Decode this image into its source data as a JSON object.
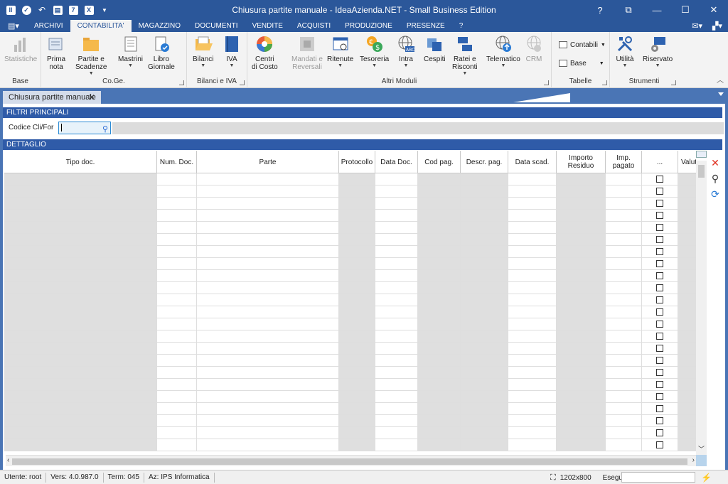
{
  "window": {
    "title": "Chiusura partite manuale - IdeaAzienda.NET - Small Business Edition",
    "help": "?",
    "restore": "⧉",
    "minimize": "—",
    "maximize": "☐",
    "close": "✕"
  },
  "qat": [
    "pin",
    "check",
    "undo",
    "print",
    "calc",
    "excel",
    "more"
  ],
  "ribbon_tabs": [
    {
      "label": "ARCHIVI",
      "active": false
    },
    {
      "label": "CONTABILITA'",
      "active": true
    },
    {
      "label": "MAGAZZINO",
      "active": false
    },
    {
      "label": "DOCUMENTI",
      "active": false
    },
    {
      "label": "VENDITE",
      "active": false
    },
    {
      "label": "ACQUISTI",
      "active": false
    },
    {
      "label": "PRODUZIONE",
      "active": false
    },
    {
      "label": "PRESENZE",
      "active": false
    },
    {
      "label": "?",
      "active": false
    }
  ],
  "ribbon": {
    "groups": [
      {
        "label": "Base"
      },
      {
        "label": "Co.Ge."
      },
      {
        "label": "Bilanci e IVA"
      },
      {
        "label": "Altri Moduli"
      },
      {
        "label": "Tabelle"
      },
      {
        "label": "Strumenti"
      }
    ],
    "buttons": {
      "statistiche": "Statistiche",
      "prima_nota": [
        "Prima",
        "nota"
      ],
      "partite": [
        "Partite e",
        "Scadenze"
      ],
      "mastrini": "Mastrini",
      "libro_giornale": [
        "Libro",
        "Giornale"
      ],
      "bilanci": "Bilanci",
      "iva": "IVA",
      "centri_costo": [
        "Centri",
        "di Costo"
      ],
      "mandati": [
        "Mandati e",
        "Reversali"
      ],
      "ritenute": "Ritenute",
      "tesoreria": "Tesoreria",
      "intra": "Intra",
      "cespiti": "Cespiti",
      "ratei": [
        "Ratei e",
        "Risconti"
      ],
      "telematico": "Telematico",
      "crm": "CRM",
      "contabili": "Contabili",
      "base": "Base",
      "utilita": "Utilità",
      "riservato": "Riservato"
    }
  },
  "doc_tab": {
    "label": "Chiusura partite manuale",
    "close": "✕"
  },
  "filters": {
    "header": "FILTRI PRINCIPALI",
    "codice_label": "Codice Cli/For",
    "codice_value": ""
  },
  "detail": {
    "header": "DETTAGLIO",
    "columns": [
      {
        "label": "Tipo doc.",
        "shaded": true
      },
      {
        "label": "Num. Doc.",
        "shaded": false
      },
      {
        "label": "Parte",
        "shaded": false
      },
      {
        "label": "Protocollo",
        "shaded": true
      },
      {
        "label": "Data Doc.",
        "shaded": false
      },
      {
        "label": "Cod pag.",
        "shaded": true
      },
      {
        "label": "Descr. pag.",
        "shaded": true
      },
      {
        "label": "Data scad.",
        "shaded": false
      },
      {
        "label": "Importo Residuo",
        "shaded": true
      },
      {
        "label": "Imp. pagato",
        "shaded": false
      },
      {
        "label": "...",
        "shaded": false,
        "checkbox": true
      },
      {
        "label": "Valut",
        "shaded": true
      }
    ]
  },
  "statusbar": {
    "utente": "Utente: root",
    "versione": "Vers: 4.0.987.0",
    "terminale": "Term: 045",
    "azienda": "Az: IPS Informatica",
    "resolution": "1202x800",
    "esegui": "Esegui"
  }
}
